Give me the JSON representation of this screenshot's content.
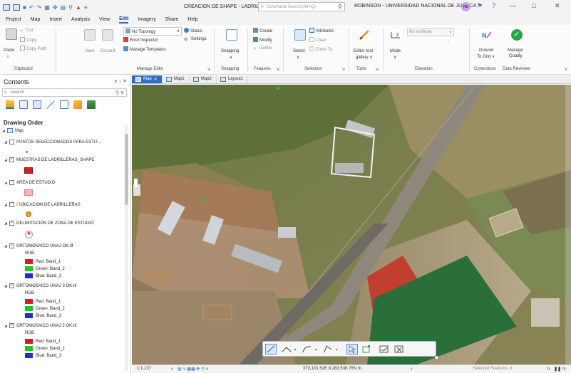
{
  "titlebar": {
    "project_name": "CREACION DE SHAPE - LADRILLERAS ∨",
    "command_search_placeholder": "Command Search (Alt+Q)",
    "user": "ROBINSON - UNIVERSIDAD NACIONAL DE JULIACA",
    "avatar_initials": "RE",
    "help": "?",
    "minimize": "—",
    "maximize": "□",
    "close": "✕"
  },
  "menu": {
    "tabs": [
      "Project",
      "Map",
      "Insert",
      "Analysis",
      "View",
      "Edit",
      "Imagery",
      "Share",
      "Help"
    ],
    "active": "Edit"
  },
  "ribbon": {
    "clipboard": {
      "paste": "Paste",
      "cut": "Cut",
      "copy": "Copy",
      "copy_path": "Copy Path",
      "label": "Clipboard"
    },
    "manage_edits": {
      "save": "Save",
      "discard": "Discard",
      "no_topology": "No Topology",
      "status": "Status",
      "error_inspector": "Error Inspector",
      "settings": "Settings",
      "manage_templates": "Manage Templates",
      "label": "Manage Edits"
    },
    "snapping": {
      "snapping": "Snapping",
      "label": "Snapping"
    },
    "features": {
      "create": "Create",
      "modify": "Modify",
      "delete": "Delete",
      "label": "Features"
    },
    "selection": {
      "select": "Select",
      "attributes": "Attributes",
      "clear": "Clear",
      "zoom_to": "Zoom To",
      "label": "Selection"
    },
    "tools": {
      "editor_tool_gallery_1": "Editor tool",
      "editor_tool_gallery_2": "gallery ∨",
      "label": "Tools"
    },
    "elevation": {
      "mode": "Mode",
      "surface_placeholder": "No surfaces",
      "label": "Elevation"
    },
    "corrections": {
      "ground_to_grid_1": "Ground",
      "ground_to_grid_2": "To Grid ∨",
      "label": "Corrections"
    },
    "data_reviewer": {
      "manage_quality_1": "Manage",
      "manage_quality_2": "Quality",
      "label": "Data Reviewer"
    }
  },
  "contents": {
    "title": "Contents",
    "controls": "∨  ↕  ✕",
    "search_placeholder": "Search",
    "drawing_order": "Drawing Order",
    "map_label": "Map",
    "layers": [
      {
        "name": "PUNTOS SELECCIONADOS PARA ESTU...",
        "checked": false,
        "warning": false
      },
      {
        "name": "MUESTRAS DE LADRILLERAS_SHAPE",
        "checked": true,
        "warning": false
      },
      {
        "name": "AREA DE ESTUDIO",
        "checked": false,
        "warning": false
      },
      {
        "name": "UBICACION DE LADRILLERAS",
        "checked": false,
        "warning": true
      },
      {
        "name": "DELIMITACION DE ZONA DE ESTUDIO",
        "checked": true,
        "warning": false
      },
      {
        "name": "ORTOMOSAICO UNAJ OK.tif",
        "checked": true,
        "warning": false
      },
      {
        "name": "ORTOMOSAICO UNAJ 3 OK.tif",
        "checked": true,
        "warning": false
      },
      {
        "name": "ORTOMOSAICO UNAJ 2 OK.tif",
        "checked": true,
        "warning": false
      }
    ],
    "rgb": "RGB",
    "bands": [
      "Red: Band_1",
      "Green: Band_2",
      "Blue: Band_3"
    ],
    "colors": {
      "red": "#e01818",
      "green": "#22c322",
      "blue": "#1f2fd6",
      "orange_point": "#f0a020",
      "area_fill": "#f2b6b6",
      "sample_fill": "#d62020"
    }
  },
  "map_tabs": [
    "Map",
    "Map1",
    "Map2",
    "Layout1"
  ],
  "status": {
    "scale": "1:1,137",
    "coords": "373,101.52E 8,283,538.76N m",
    "selected": "Selected Features: 0"
  },
  "theme": {
    "accent": "#2e6fbd",
    "ribbon_bg": "#fbfbfb",
    "chrome_bg": "#f3f3f3"
  }
}
